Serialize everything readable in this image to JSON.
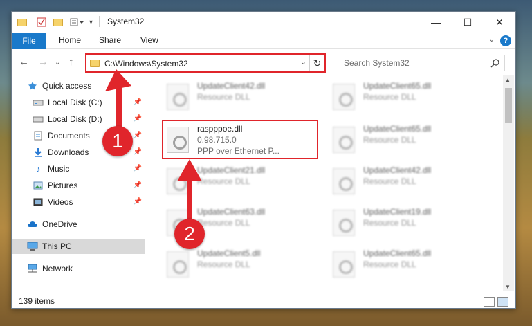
{
  "window": {
    "title": "System32",
    "controls": {
      "minimize": "—",
      "maximize": "☐",
      "close": "✕"
    }
  },
  "ribbon": {
    "tabs": [
      "File",
      "Home",
      "Share",
      "View"
    ],
    "help": "?"
  },
  "navigation": {
    "address": "C:\\Windows\\System32",
    "search_placeholder": "Search System32"
  },
  "sidebar": {
    "items": [
      {
        "label": "Quick access",
        "icon": "star-icon"
      },
      {
        "label": "Local Disk (C:)",
        "icon": "drive-icon",
        "pinned": true
      },
      {
        "label": "Local Disk (D:)",
        "icon": "drive-icon",
        "pinned": true
      },
      {
        "label": "Documents",
        "icon": "documents-icon",
        "pinned": true
      },
      {
        "label": "Downloads",
        "icon": "download-icon",
        "pinned": true
      },
      {
        "label": "Music",
        "icon": "music-icon",
        "pinned": true
      },
      {
        "label": "Pictures",
        "icon": "pictures-icon",
        "pinned": true
      },
      {
        "label": "Videos",
        "icon": "videos-icon",
        "pinned": true
      },
      {
        "label": "OneDrive",
        "icon": "cloud-icon"
      },
      {
        "label": "This PC",
        "icon": "computer-icon",
        "selected": true
      },
      {
        "label": "Network",
        "icon": "network-icon"
      }
    ]
  },
  "files": {
    "left": [
      {
        "name": "UpdateClient42.dll",
        "desc": "Resource DLL"
      },
      {
        "name": "raspppoe.dll",
        "desc": "0.98.715.0",
        "desc2": "PPP over Ethernet P..."
      },
      {
        "name": "UpdateClient21.dll",
        "desc": "Resource DLL"
      },
      {
        "name": "UpdateClient63.dll",
        "desc": "Resource DLL"
      },
      {
        "name": "UpdateClient5.dll",
        "desc": "Resource DLL"
      }
    ],
    "right": [
      {
        "name": "UpdateClient65.dll",
        "desc": "Resource DLL"
      },
      {
        "name": "UpdateClient65.dll",
        "desc": "Resource DLL"
      },
      {
        "name": "UpdateClient42.dll",
        "desc": "Resource DLL"
      },
      {
        "name": "UpdateClient19.dll",
        "desc": "Resource DLL"
      },
      {
        "name": "UpdateClient65.dll",
        "desc": "Resource DLL"
      }
    ]
  },
  "status": {
    "item_count": "139 items"
  },
  "annotations": {
    "marker_1": "1",
    "marker_2": "2",
    "color": "#e0252b"
  }
}
